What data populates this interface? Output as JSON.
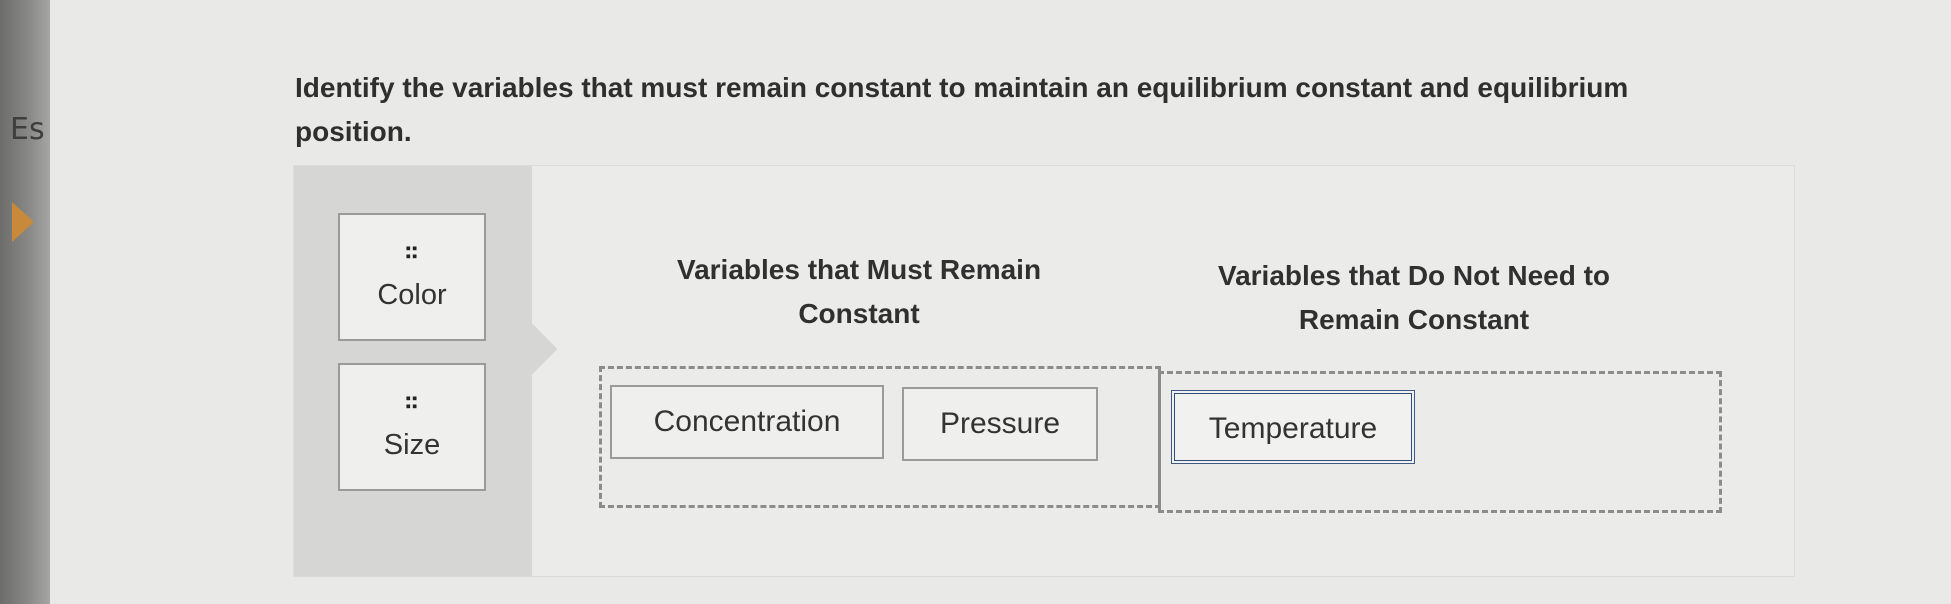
{
  "sidebar": {
    "fragment_text": "Es"
  },
  "question": {
    "text": "Identify the variables that must remain constant to maintain an equilibrium constant and equilibrium position."
  },
  "bank": {
    "items": [
      {
        "label": "Color"
      },
      {
        "label": "Size"
      }
    ]
  },
  "columns": {
    "must_remain": {
      "header": "Variables that Must Remain Constant",
      "items": [
        "Concentration",
        "Pressure"
      ]
    },
    "not_needed": {
      "header": "Variables that Do Not Need to Remain Constant",
      "items": [
        "Temperature"
      ]
    }
  },
  "icons": {
    "drag_handle": "drag-grip-icon",
    "arrow": "play-arrow-icon"
  },
  "colors": {
    "selected_border": "#3f5a86",
    "arrow": "#c88a3a"
  }
}
